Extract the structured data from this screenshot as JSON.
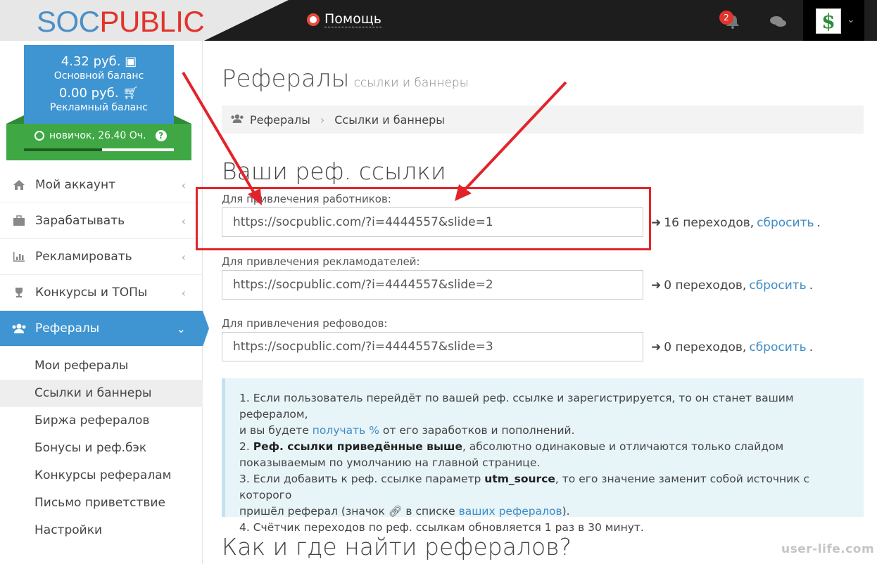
{
  "logo": {
    "part1": "SOC",
    "part2": "PUBLIC"
  },
  "topbar": {
    "help_label": "Помощь",
    "notifications_count": "2"
  },
  "sidebar": {
    "balance_main_amount": "4.32 руб.",
    "balance_main_label": "Основной баланс",
    "balance_ad_amount": "0.00 руб.",
    "balance_ad_label": "Рекламный баланс",
    "level_text": "новичок, 26.40 Оч.",
    "level_progress": 0.52,
    "menu": [
      {
        "label": "Мой аккаунт",
        "icon": "home-icon"
      },
      {
        "label": "Зарабатывать",
        "icon": "briefcase-icon"
      },
      {
        "label": "Рекламировать",
        "icon": "bar-chart-icon"
      },
      {
        "label": "Конкурсы и ТОПы",
        "icon": "trophy-icon"
      },
      {
        "label": "Рефералы",
        "icon": "users-icon"
      }
    ],
    "submenu": [
      "Мои рефералы",
      "Ссылки и баннеры",
      "Биржа рефералов",
      "Бонусы и реф.бэк",
      "Конкурсы рефералам",
      "Письмо приветствие",
      "Настройки"
    ]
  },
  "page": {
    "title": "Рефералы",
    "subtitle": "ссылки и баннеры",
    "breadcrumb": [
      "Рефералы",
      "Ссылки и баннеры"
    ],
    "section_title": "Ваши реф. ссылки",
    "links": [
      {
        "label": "Для привлечения работников:",
        "url": "https://socpublic.com/?i=4444557&slide=1",
        "count": "16 переходов,",
        "reset": "сбросить"
      },
      {
        "label": "Для привлечения рекламодателей:",
        "url": "https://socpublic.com/?i=4444557&slide=2",
        "count": "0 переходов,",
        "reset": "сбросить"
      },
      {
        "label": "Для привлечения рефоводов:",
        "url": "https://socpublic.com/?i=4444557&slide=3",
        "count": "0 переходов,",
        "reset": "сбросить"
      }
    ],
    "info": {
      "p1a": "1. Если пользователь перейдёт по вашей реф. ссылке и зарегистрируется, то он станет вашим рефералом,",
      "p1b": "и вы будете",
      "p1_link": "получать %",
      "p1c": "от его заработков и пополнений.",
      "p2_prefix": "2.",
      "p2_bold": "Реф. ссылки приведённые выше",
      "p2a": ", абсолютно одинаковые и отличаются только слайдом",
      "p2b": "показываемым по умолчанию на главной странице.",
      "p3a": "3. Если добавить к реф. ссылке параметр",
      "p3_bold": "utm_source",
      "p3b": ", то его значение заменит собой источник с которого",
      "p3c": "пришёл реферал (значок",
      "p3d": "в списке",
      "p3_link": "ваших рефералов",
      "p3e": ").",
      "p4": "4. Счётчик переходов по реф. ссылкам обновляется 1 раз в 30 минут."
    },
    "bottom_title": "Как и где найти рефералов?",
    "watermark": "user-life.com"
  },
  "colors": {
    "accent": "#3f95d2",
    "green": "#3fa845",
    "annotation_red": "#e2242a",
    "link": "#3f8cc6"
  }
}
